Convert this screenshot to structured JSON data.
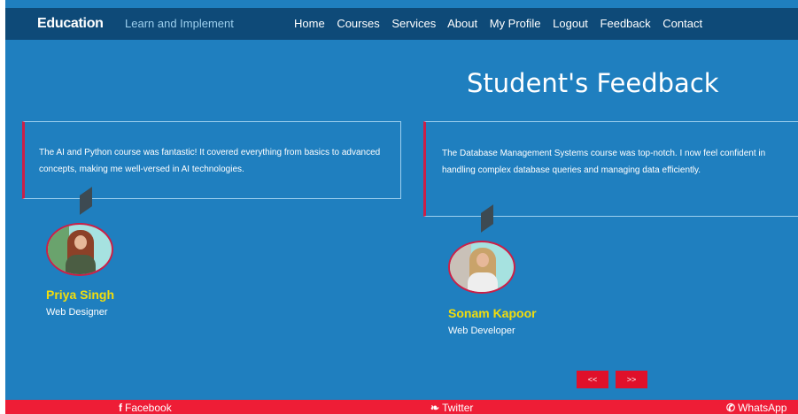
{
  "navbar": {
    "brand": "Education",
    "tagline": "Learn and Implement",
    "links": [
      "Home",
      "Courses",
      "Services",
      "About",
      "My Profile",
      "Logout",
      "Feedback",
      "Contact"
    ]
  },
  "main": {
    "heading": "Student's Feedback",
    "testimonials": [
      {
        "text": "The AI and Python course was fantastic! It covered everything from basics to advanced concepts, making me well-versed in AI technologies.",
        "name": "Priya Singh",
        "role": "Web Designer"
      },
      {
        "text": "The Database Management Systems course was top-notch. I now feel confident in handling complex database queries and managing data efficiently.",
        "name": "Sonam Kapoor",
        "role": "Web Developer"
      }
    ],
    "carousel": {
      "prev_label": "<<",
      "next_label": ">>"
    }
  },
  "footer": {
    "links": [
      {
        "label": "Facebook",
        "icon": "facebook-icon",
        "glyph": "f"
      },
      {
        "label": "Twitter",
        "icon": "twitter-icon",
        "glyph": "❧"
      },
      {
        "label": "WhatsApp",
        "icon": "whatsapp-icon",
        "glyph": "✆"
      }
    ]
  },
  "colors": {
    "background": "#1f7fbf",
    "navbar": "#0e4a78",
    "accent_red": "#e0102a",
    "footer": "#ee1d36",
    "name_yellow": "#f2dd0c"
  }
}
